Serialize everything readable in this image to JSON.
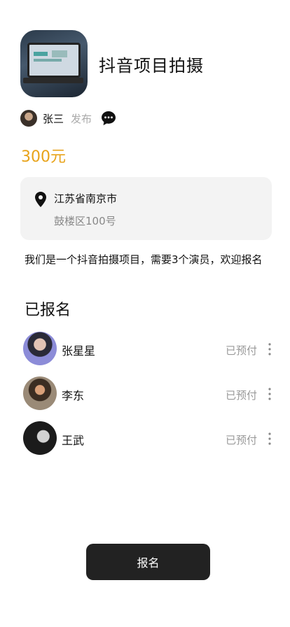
{
  "project": {
    "title": "抖音项目拍摄"
  },
  "author": {
    "name": "张三",
    "action": "发布"
  },
  "price": "300元",
  "address": {
    "line1": "江苏省南京市",
    "line2": "鼓楼区100号"
  },
  "description": "我们是一个抖音拍摄项目，需要3个演员，欢迎报名",
  "registered": {
    "title": "已报名",
    "people": [
      {
        "name": "张星星",
        "status": "已预付"
      },
      {
        "name": "李东",
        "status": "已预付"
      },
      {
        "name": "王武",
        "status": "已预付"
      }
    ]
  },
  "signup_button": "报名",
  "colors": {
    "price": "#e8a31a",
    "button_bg": "#222222",
    "card_bg": "#f3f3f3"
  }
}
